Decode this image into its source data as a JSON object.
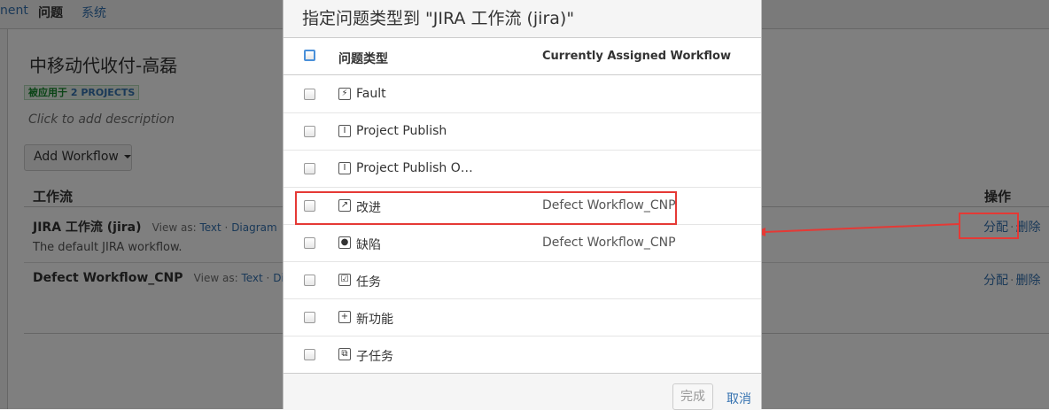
{
  "topnav": {
    "item_ment": "nent",
    "item_issues": "问题",
    "item_system": "系统"
  },
  "scheme": {
    "title": "中移动代收付-高磊",
    "projects_prefix": "被应用于",
    "projects_link": "2 PROJECTS",
    "description_placeholder": "Click to add description",
    "add_workflow_label": "Add Workflow"
  },
  "table": {
    "col_workflow": "工作流",
    "col_actions": "操作",
    "rows": [
      {
        "name": "JIRA 工作流 (jira)",
        "view_as": "View as:",
        "text_link": "Text",
        "diagram_link": "Diagram",
        "description": "The default JIRA workflow.",
        "assign": "分配",
        "delete": "删除"
      },
      {
        "name": "Defect Workflow_CNP",
        "view_as": "View as:",
        "text_link": "Text",
        "diagram_link": "Diagram",
        "assign": "分配",
        "delete": "删除"
      }
    ]
  },
  "dialog": {
    "title": "指定问题类型到 \"JIRA 工作流 (jira)\"",
    "col_issue_type": "问题类型",
    "col_current_workflow": "Currently Assigned Workflow",
    "issue_types": [
      {
        "name": "Fault",
        "workflow": "",
        "icon": "fault-icon",
        "glyph": "⚡"
      },
      {
        "name": "Project Publish",
        "workflow": "",
        "icon": "project-publish-icon",
        "glyph": "I"
      },
      {
        "name": "Project Publish O…",
        "workflow": "",
        "icon": "project-publish-icon",
        "glyph": "I"
      },
      {
        "name": "改进",
        "workflow": "Defect Workflow_CNP",
        "icon": "improvement-icon",
        "glyph": "↗"
      },
      {
        "name": "缺陷",
        "workflow": "Defect Workflow_CNP",
        "icon": "bug-icon",
        "glyph": "●"
      },
      {
        "name": "任务",
        "workflow": "",
        "icon": "task-icon",
        "glyph": "☑"
      },
      {
        "name": "新功能",
        "workflow": "",
        "icon": "new-feature-icon",
        "glyph": "+"
      },
      {
        "name": "子任务",
        "workflow": "",
        "icon": "subtask-icon",
        "glyph": "⧉"
      }
    ],
    "done_label": "完成",
    "cancel_label": "取消"
  },
  "colors": {
    "link": "#3572b0",
    "annotation": "#e53935",
    "lozenge_green": "#14892c"
  }
}
